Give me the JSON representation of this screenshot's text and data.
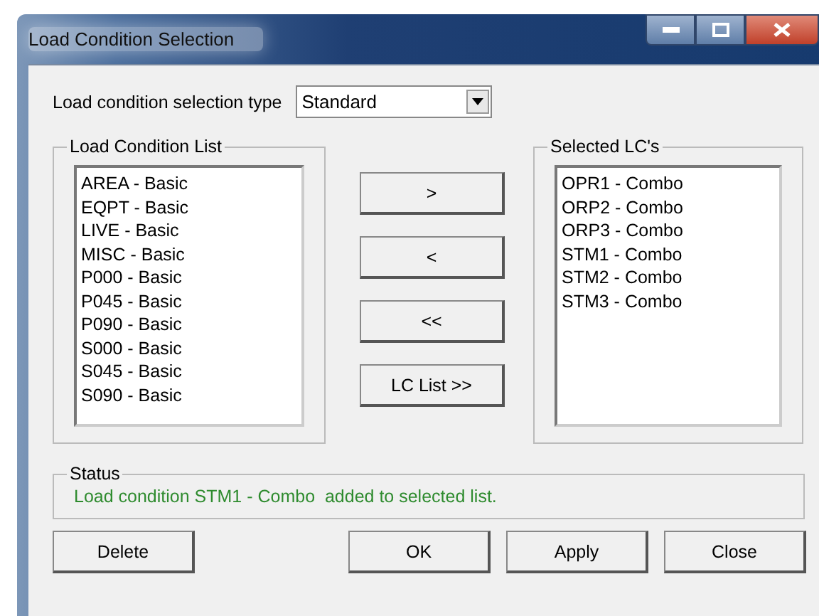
{
  "window": {
    "title": "Load Condition Selection"
  },
  "selection_type": {
    "label": "Load condition selection type",
    "value": "Standard"
  },
  "load_condition_list": {
    "title": "Load Condition List",
    "items": [
      "AREA - Basic",
      "EQPT - Basic",
      "LIVE - Basic",
      "MISC - Basic",
      "P000 - Basic",
      "P045 - Basic",
      "P090 - Basic",
      "S000 - Basic",
      "S045 - Basic",
      "S090 - Basic"
    ]
  },
  "transfer_buttons": [
    ">",
    "<",
    "<<",
    "LC List >>"
  ],
  "selected_lcs": {
    "title": "Selected LC's",
    "items": [
      "OPR1 - Combo",
      "ORP2 - Combo",
      "ORP3 - Combo",
      "STM1 - Combo",
      "STM2 - Combo",
      "STM3 - Combo"
    ]
  },
  "status": {
    "title": "Status",
    "message": "Load condition STM1 - Combo  added to selected list."
  },
  "buttons": [
    "Delete",
    "OK",
    "Apply",
    "Close"
  ]
}
